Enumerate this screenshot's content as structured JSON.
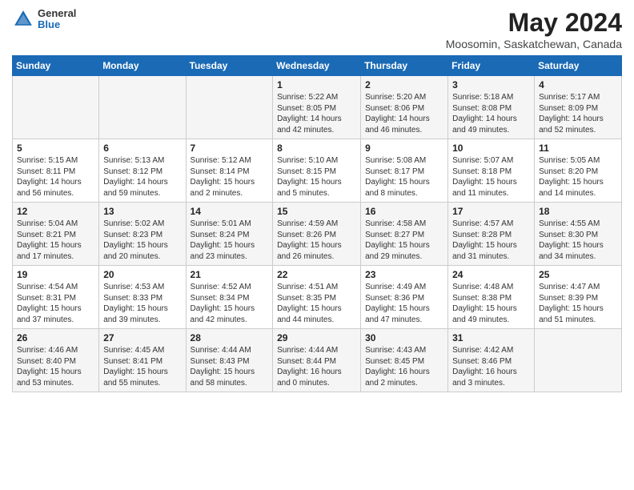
{
  "header": {
    "logo_general": "General",
    "logo_blue": "Blue",
    "title": "May 2024",
    "subtitle": "Moosomin, Saskatchewan, Canada"
  },
  "days_of_week": [
    "Sunday",
    "Monday",
    "Tuesday",
    "Wednesday",
    "Thursday",
    "Friday",
    "Saturday"
  ],
  "weeks": [
    [
      {
        "day": "",
        "info": ""
      },
      {
        "day": "",
        "info": ""
      },
      {
        "day": "",
        "info": ""
      },
      {
        "day": "1",
        "info": "Sunrise: 5:22 AM\nSunset: 8:05 PM\nDaylight: 14 hours\nand 42 minutes."
      },
      {
        "day": "2",
        "info": "Sunrise: 5:20 AM\nSunset: 8:06 PM\nDaylight: 14 hours\nand 46 minutes."
      },
      {
        "day": "3",
        "info": "Sunrise: 5:18 AM\nSunset: 8:08 PM\nDaylight: 14 hours\nand 49 minutes."
      },
      {
        "day": "4",
        "info": "Sunrise: 5:17 AM\nSunset: 8:09 PM\nDaylight: 14 hours\nand 52 minutes."
      }
    ],
    [
      {
        "day": "5",
        "info": "Sunrise: 5:15 AM\nSunset: 8:11 PM\nDaylight: 14 hours\nand 56 minutes."
      },
      {
        "day": "6",
        "info": "Sunrise: 5:13 AM\nSunset: 8:12 PM\nDaylight: 14 hours\nand 59 minutes."
      },
      {
        "day": "7",
        "info": "Sunrise: 5:12 AM\nSunset: 8:14 PM\nDaylight: 15 hours\nand 2 minutes."
      },
      {
        "day": "8",
        "info": "Sunrise: 5:10 AM\nSunset: 8:15 PM\nDaylight: 15 hours\nand 5 minutes."
      },
      {
        "day": "9",
        "info": "Sunrise: 5:08 AM\nSunset: 8:17 PM\nDaylight: 15 hours\nand 8 minutes."
      },
      {
        "day": "10",
        "info": "Sunrise: 5:07 AM\nSunset: 8:18 PM\nDaylight: 15 hours\nand 11 minutes."
      },
      {
        "day": "11",
        "info": "Sunrise: 5:05 AM\nSunset: 8:20 PM\nDaylight: 15 hours\nand 14 minutes."
      }
    ],
    [
      {
        "day": "12",
        "info": "Sunrise: 5:04 AM\nSunset: 8:21 PM\nDaylight: 15 hours\nand 17 minutes."
      },
      {
        "day": "13",
        "info": "Sunrise: 5:02 AM\nSunset: 8:23 PM\nDaylight: 15 hours\nand 20 minutes."
      },
      {
        "day": "14",
        "info": "Sunrise: 5:01 AM\nSunset: 8:24 PM\nDaylight: 15 hours\nand 23 minutes."
      },
      {
        "day": "15",
        "info": "Sunrise: 4:59 AM\nSunset: 8:26 PM\nDaylight: 15 hours\nand 26 minutes."
      },
      {
        "day": "16",
        "info": "Sunrise: 4:58 AM\nSunset: 8:27 PM\nDaylight: 15 hours\nand 29 minutes."
      },
      {
        "day": "17",
        "info": "Sunrise: 4:57 AM\nSunset: 8:28 PM\nDaylight: 15 hours\nand 31 minutes."
      },
      {
        "day": "18",
        "info": "Sunrise: 4:55 AM\nSunset: 8:30 PM\nDaylight: 15 hours\nand 34 minutes."
      }
    ],
    [
      {
        "day": "19",
        "info": "Sunrise: 4:54 AM\nSunset: 8:31 PM\nDaylight: 15 hours\nand 37 minutes."
      },
      {
        "day": "20",
        "info": "Sunrise: 4:53 AM\nSunset: 8:33 PM\nDaylight: 15 hours\nand 39 minutes."
      },
      {
        "day": "21",
        "info": "Sunrise: 4:52 AM\nSunset: 8:34 PM\nDaylight: 15 hours\nand 42 minutes."
      },
      {
        "day": "22",
        "info": "Sunrise: 4:51 AM\nSunset: 8:35 PM\nDaylight: 15 hours\nand 44 minutes."
      },
      {
        "day": "23",
        "info": "Sunrise: 4:49 AM\nSunset: 8:36 PM\nDaylight: 15 hours\nand 47 minutes."
      },
      {
        "day": "24",
        "info": "Sunrise: 4:48 AM\nSunset: 8:38 PM\nDaylight: 15 hours\nand 49 minutes."
      },
      {
        "day": "25",
        "info": "Sunrise: 4:47 AM\nSunset: 8:39 PM\nDaylight: 15 hours\nand 51 minutes."
      }
    ],
    [
      {
        "day": "26",
        "info": "Sunrise: 4:46 AM\nSunset: 8:40 PM\nDaylight: 15 hours\nand 53 minutes."
      },
      {
        "day": "27",
        "info": "Sunrise: 4:45 AM\nSunset: 8:41 PM\nDaylight: 15 hours\nand 55 minutes."
      },
      {
        "day": "28",
        "info": "Sunrise: 4:44 AM\nSunset: 8:43 PM\nDaylight: 15 hours\nand 58 minutes."
      },
      {
        "day": "29",
        "info": "Sunrise: 4:44 AM\nSunset: 8:44 PM\nDaylight: 16 hours\nand 0 minutes."
      },
      {
        "day": "30",
        "info": "Sunrise: 4:43 AM\nSunset: 8:45 PM\nDaylight: 16 hours\nand 2 minutes."
      },
      {
        "day": "31",
        "info": "Sunrise: 4:42 AM\nSunset: 8:46 PM\nDaylight: 16 hours\nand 3 minutes."
      },
      {
        "day": "",
        "info": ""
      }
    ]
  ]
}
